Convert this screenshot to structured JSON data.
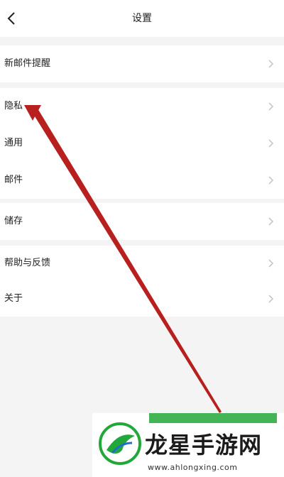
{
  "header": {
    "title": "设置",
    "back_icon": "chevron-left-icon"
  },
  "settings": {
    "new_mail_alert": "新邮件提醒",
    "privacy": "隐私",
    "general": "通用",
    "mail": "邮件",
    "storage": "储存",
    "help_feedback": "帮助与反馈",
    "about": "关于"
  },
  "watermark": {
    "title": "龙星手游网",
    "url": "www.ahlongxing.com"
  },
  "colors": {
    "background": "#f4f4f4",
    "card": "#ffffff",
    "annotation_arrow": "#b8201f",
    "watermark_green": "#22a83a"
  }
}
